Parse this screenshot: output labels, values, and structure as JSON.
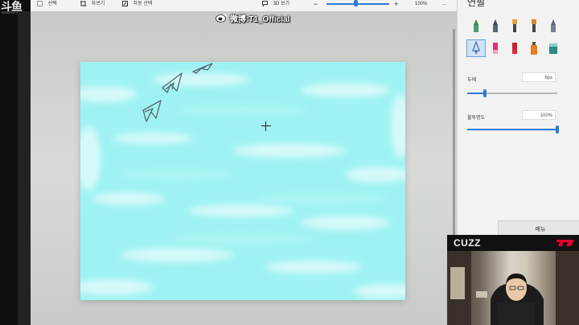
{
  "stream": {
    "logo_cn": "斗鱼",
    "logo_en": "DOUYU.COM",
    "watermark": "微博:T1_Official"
  },
  "toolbar": {
    "select_label": "선택",
    "crop_label": "자르기",
    "magic_select_label": "자동 선택",
    "view3d_label": "3D 보기",
    "zoom_minus": "−",
    "zoom_plus": "+",
    "zoom_value": "100%",
    "zoom_level": 0.45,
    "more_label": "..."
  },
  "panel": {
    "title": "연필",
    "thickness_label": "두께",
    "thickness_value": "6px",
    "thickness_fraction": 0.2,
    "opacity_label": "불투명도",
    "opacity_value": "100%",
    "opacity_fraction": 1.0,
    "menu_label": "메뉴",
    "brushes": [
      {
        "name": "marker",
        "color": "#2e8b57"
      },
      {
        "name": "calligraphy-pen",
        "color": "#3b4b5c"
      },
      {
        "name": "oil-brush",
        "color": "#e6a23c"
      },
      {
        "name": "watercolor",
        "color": "#d98a2a"
      },
      {
        "name": "pixel-pen",
        "color": "#5a6a7a"
      },
      {
        "name": "pencil",
        "color": "#4a6fa5",
        "selected": true
      },
      {
        "name": "eraser",
        "color": "#d4357a"
      },
      {
        "name": "crayon",
        "color": "#c23",
        "extra": "#e24"
      },
      {
        "name": "spray-can",
        "color": "#e57c1f"
      },
      {
        "name": "fill-bucket",
        "color": "#2c8b80"
      }
    ]
  },
  "webcam": {
    "name": "CUZZ"
  },
  "colors": {
    "canvas": "#9ff2f3",
    "accent": "#2b7bd1"
  }
}
